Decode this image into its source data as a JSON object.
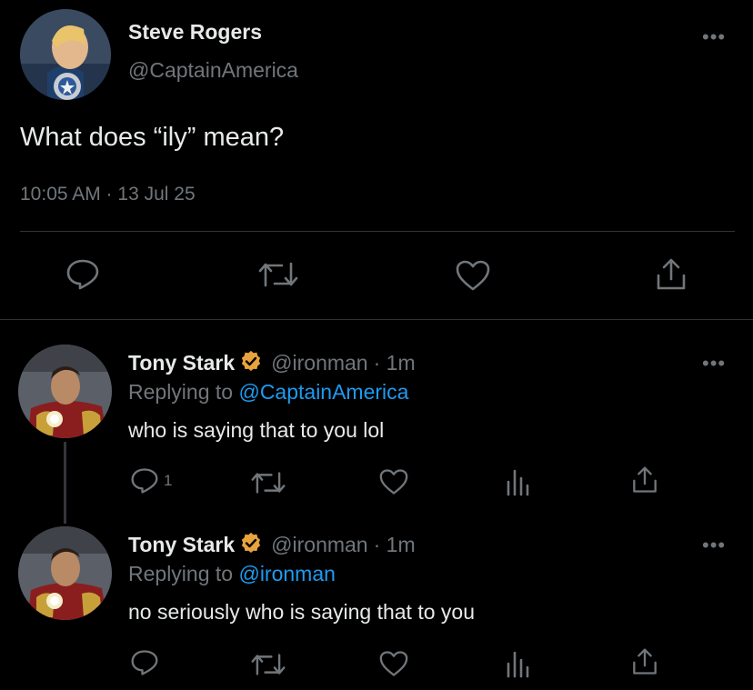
{
  "main_tweet": {
    "author_name": "Steve Rogers",
    "author_handle": "@CaptainAmerica",
    "text": "What does “ily” mean?",
    "timestamp": "10:05 AM · 13 Jul 25",
    "actions": [
      "reply-icon",
      "retweet-icon",
      "like-icon",
      "share-icon"
    ]
  },
  "replies": [
    {
      "author_name": "Tony Stark",
      "verified": true,
      "author_handle": "@ironman",
      "time": "· 1m",
      "replying_prefix": "Replying to",
      "replying_to": "@CaptainAmerica",
      "text": "who is saying that to you lol",
      "reply_count": "1",
      "actions": [
        "reply-icon",
        "retweet-icon",
        "like-icon",
        "views-icon",
        "share-icon"
      ]
    },
    {
      "author_name": "Tony Stark",
      "verified": true,
      "author_handle": "@ironman",
      "time": "· 1m",
      "replying_prefix": "Replying to",
      "replying_to": "@ironman",
      "text": "no seriously who is saying that to you",
      "reply_count": "",
      "actions": [
        "reply-icon",
        "retweet-icon",
        "like-icon",
        "views-icon",
        "share-icon"
      ]
    }
  ],
  "more_label": "•••",
  "colors": {
    "background": "#000000",
    "text": "#e7e9ea",
    "muted": "#71767b",
    "link": "#1d9bf0",
    "verified_badge": "#e8a33d"
  }
}
